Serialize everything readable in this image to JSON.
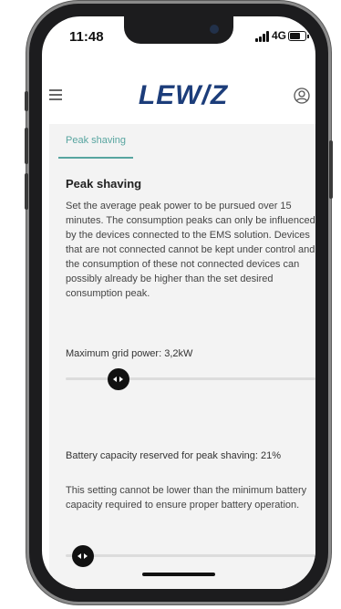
{
  "status_bar": {
    "time": "11:48",
    "network": "4G"
  },
  "app": {
    "logo": "LEW/Z"
  },
  "tabs": [
    {
      "label": "Peak shaving"
    }
  ],
  "section": {
    "title": "Peak shaving",
    "description": "Set the average peak power to be pursued over 15 minutes. The consumption peaks can only be influenced by the devices connected to the EMS solution. Devices that are not connected cannot be kept under control and the consumption of these not connected devices can possibly already be higher than the set desired consumption peak."
  },
  "grid_power": {
    "label": "Maximum grid power: 3,2kW",
    "slider_fraction": 0.21
  },
  "battery": {
    "label": "Battery capacity reserved for peak shaving: 21%",
    "note": "This setting cannot be lower than the minimum battery capacity required to ensure proper battery operation.",
    "slider_fraction": 0.07
  },
  "colors": {
    "accent": "#58a5a0",
    "logo": "#1c3d7a",
    "thumb": "#111111"
  },
  "icons": {
    "menu": "hamburger-icon",
    "user": "user-icon"
  }
}
